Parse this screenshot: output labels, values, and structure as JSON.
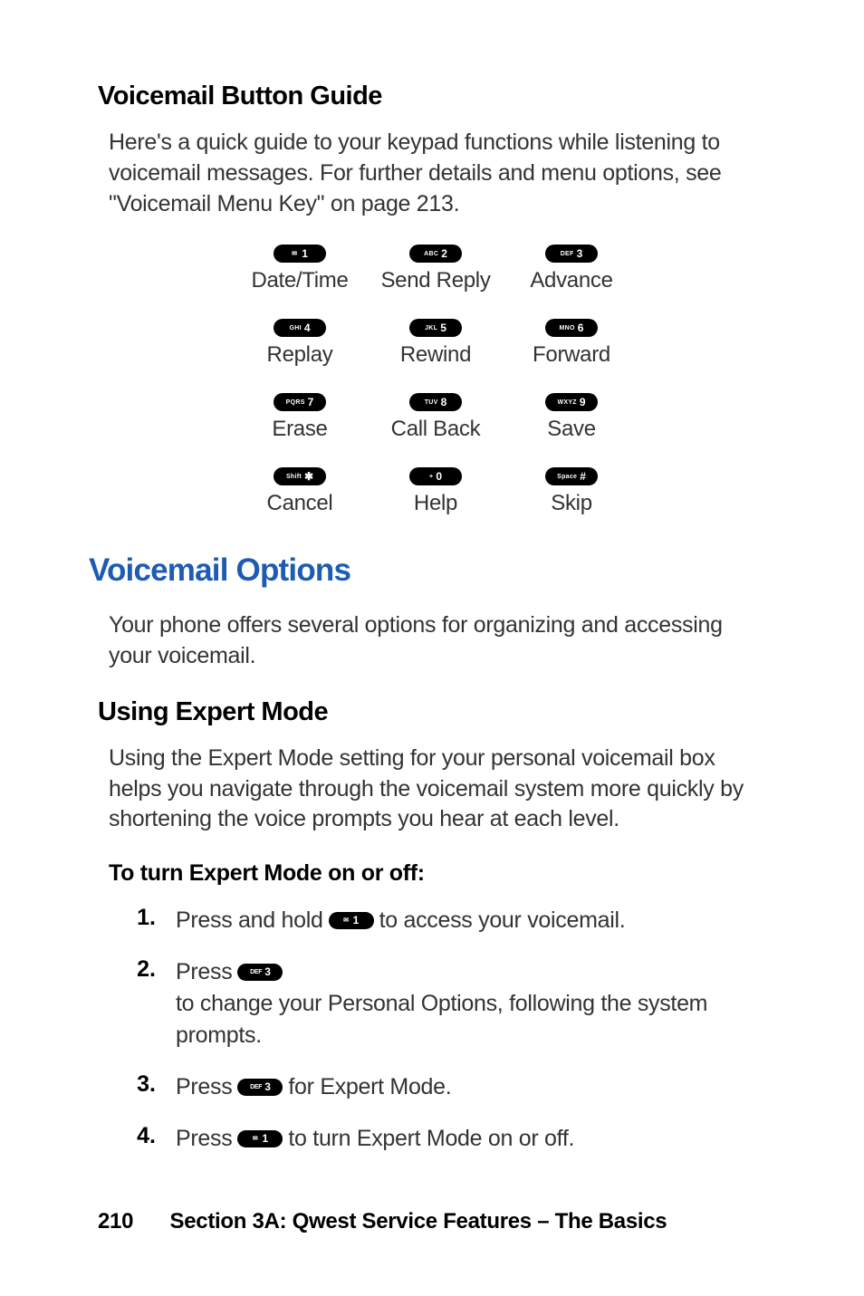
{
  "heading_button_guide": "Voicemail Button Guide",
  "intro_text": "Here's a quick guide to your keypad functions while listening to voicemail messages. For further details and menu options, see \"Voicemail Menu Key\" on page 213.",
  "keypad": [
    {
      "sub": "✉",
      "main": "1",
      "label": "Date/Time"
    },
    {
      "sub": "ABC",
      "main": "2",
      "label": "Send Reply"
    },
    {
      "sub": "DEF",
      "main": "3",
      "label": "Advance"
    },
    {
      "sub": "GHI",
      "main": "4",
      "label": "Replay"
    },
    {
      "sub": "JKL",
      "main": "5",
      "label": "Rewind"
    },
    {
      "sub": "MNO",
      "main": "6",
      "label": "Forward"
    },
    {
      "sub": "PQRS",
      "main": "7",
      "label": "Erase"
    },
    {
      "sub": "TUV",
      "main": "8",
      "label": "Call Back"
    },
    {
      "sub": "WXYZ",
      "main": "9",
      "label": "Save"
    },
    {
      "sub": "Shift",
      "main": "✱",
      "label": "Cancel"
    },
    {
      "sub": "+",
      "main": "0",
      "label": "Help"
    },
    {
      "sub": "Space",
      "main": "#",
      "label": "Skip"
    }
  ],
  "heading_options": "Voicemail Options",
  "options_intro": "Your phone offers several options for organizing and accessing your voicemail.",
  "heading_expert": "Using Expert Mode",
  "expert_intro": "Using the Expert Mode setting for your personal voicemail box helps you navigate through the voicemail system more quickly by shortening the voice prompts you hear at each level.",
  "expert_toggle_lead": "To turn Expert Mode on or off:",
  "steps": {
    "s1_a": "Press and hold ",
    "s1_b": " to access your voicemail.",
    "s2_a": "Press ",
    "s2_b": " to change your Personal Options, following the system prompts.",
    "s3_a": "Press ",
    "s3_b": " for Expert Mode.",
    "s4_a": "Press ",
    "s4_b": " to turn Expert Mode on or off."
  },
  "step_keys": {
    "k1": {
      "sub": "✉",
      "main": "1"
    },
    "k3a": {
      "sub": "DEF",
      "main": "3"
    },
    "k3b": {
      "sub": "DEF",
      "main": "3"
    },
    "k1b": {
      "sub": "✉",
      "main": "1"
    }
  },
  "footer_page": "210",
  "footer_text": "Section 3A: Qwest Service Features – The Basics"
}
